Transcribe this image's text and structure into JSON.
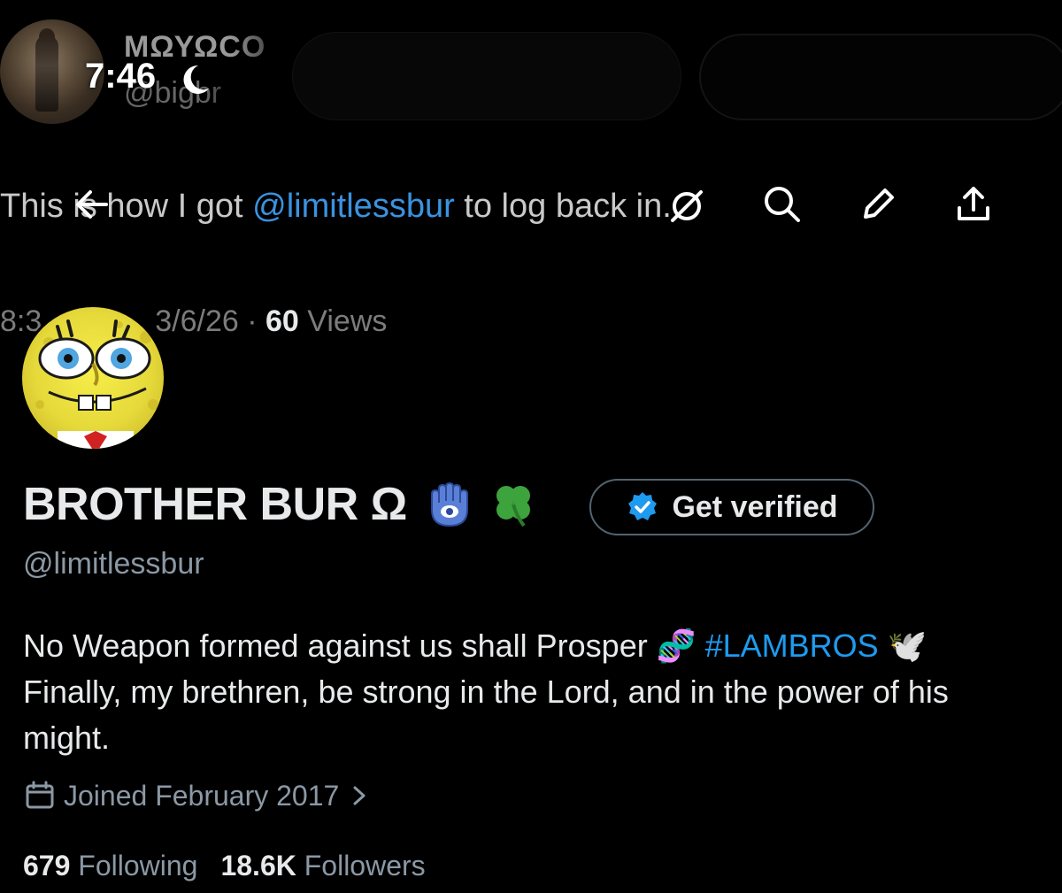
{
  "ghost": {
    "name": "ΜΩΥΩCO",
    "handle": "@bigbr",
    "tweet_pre": "This is how I got ",
    "tweet_mention": "@limitlessbur",
    "tweet_post": " to log back in.",
    "meta_time": "8:3",
    "meta_date": "3/6/26 · ",
    "meta_views_count": "60",
    "meta_views_label": " Views"
  },
  "status_bar": {
    "time": "7:46"
  },
  "nav": {
    "icons": [
      "back-arrow-icon",
      "hide-icon",
      "search-icon",
      "edit-icon",
      "share-icon"
    ]
  },
  "profile": {
    "display_name": "BROTHER BUR Ω",
    "emoji_1": "🪬",
    "emoji_2": "🍀",
    "get_verified_label": "Get verified",
    "handle": "@limitlessbur",
    "bio_line1_pre": "No Weapon formed against us shall Prosper ",
    "bio_emoji_dna": "🧬",
    "bio_hashtag": "#LAMBROS",
    "bio_emoji_dove": "🕊️",
    "bio_line2": "Finally, my brethren, be strong in the Lord, and in the power of his might.",
    "joined": "Joined February 2017",
    "following_count": "679",
    "following_label": "Following",
    "followers_count": "18.6K",
    "followers_label": "Followers"
  },
  "colors": {
    "background": "#000000",
    "text_primary": "#e7e9ea",
    "text_secondary": "#8b98a5",
    "link": "#1d9bf0",
    "verified_badge": "#1d9bf0"
  }
}
